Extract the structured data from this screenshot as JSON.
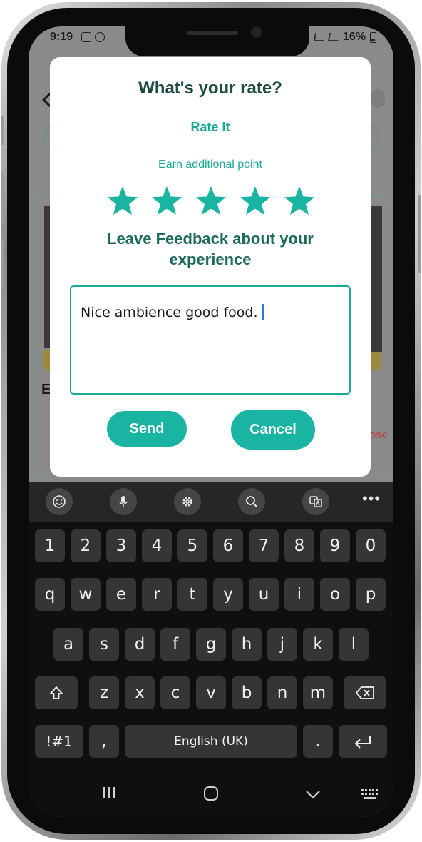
{
  "status_bar": {
    "time": "9:19",
    "battery": "16%"
  },
  "background_app": {
    "partial_text": "E",
    "partial_link": "ose"
  },
  "dialog": {
    "title": "What's your rate?",
    "rate_label": "Rate It",
    "earn_label": "Earn additional point",
    "rating": 5,
    "max_rating": 5,
    "star_color": "#1ab5a2",
    "feedback_heading_line1": "Leave Feedback about your",
    "feedback_heading_line2": "experience",
    "feedback_value": "Nice ambience good food.",
    "send_label": "Send",
    "cancel_label": "Cancel"
  },
  "keyboard": {
    "toolbar": [
      "emoji-icon",
      "microphone-icon",
      "gear-icon",
      "search-icon",
      "translate-icon",
      "more-icon"
    ],
    "rows": [
      [
        "1",
        "2",
        "3",
        "4",
        "5",
        "6",
        "7",
        "8",
        "9",
        "0"
      ],
      [
        "q",
        "w",
        "e",
        "r",
        "t",
        "y",
        "u",
        "i",
        "o",
        "p"
      ],
      [
        "a",
        "s",
        "d",
        "f",
        "g",
        "h",
        "j",
        "k",
        "l"
      ],
      [
        "z",
        "x",
        "c",
        "v",
        "b",
        "n",
        "m"
      ]
    ],
    "symbols_label": "!#1",
    "comma_label": ",",
    "space_label": "English (UK)",
    "period_label": "."
  },
  "colors": {
    "accent": "#1ab5a2",
    "title": "#1d4b43"
  }
}
